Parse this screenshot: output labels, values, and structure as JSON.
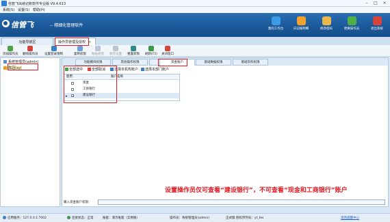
{
  "window": {
    "title": "信管飞出纳记账软件专业版 V9.4.613"
  },
  "menu": [
    "系统(S)",
    "设置(S)",
    "帮助(H)"
  ],
  "banner": {
    "logo": "信管飞",
    "slogan": "-- 精细化管理软件",
    "buttons": [
      "我的工作台",
      "日记账明细",
      "修改密码",
      "更换操作员",
      "退出系统"
    ]
  },
  "tabs": [
    "功能导航区",
    "操作员管理及授权"
  ],
  "toolbar": [
    "添加操作员",
    "删除操作员",
    "设置登录限制",
    "复制权限",
    "粘贴权限",
    "保存设置",
    "重置权限",
    "刷新(F5)",
    "关闭窗口"
  ],
  "tree": [
    "系统管理员(admin)",
    "陈冠(zy)"
  ],
  "subtabs": [
    "功能模块权限",
    "其他操作权限",
    "数据权限",
    "资金账户",
    "基础数据权限",
    "基础资料权限"
  ],
  "actions": [
    "全部选中",
    "全部取消",
    "选择本机构账户",
    "选择本部门账户"
  ],
  "grid": {
    "headers": [
      "使用",
      "账户名称"
    ],
    "rows": [
      {
        "name": "现金",
        "checked": false
      },
      {
        "name": "工商银行",
        "checked": false
      },
      {
        "name": "建设银行",
        "checked": true
      }
    ]
  },
  "annotation": "设置操作员仅可查看“建设银行”，不可查看“现金和工商银行”账户",
  "input_label": "输入资金账户权限：",
  "status": {
    "server": "应用服务：127.0.0.1:7002",
    "connection": "连接状态：正常",
    "ledger": "账套：演示账套（实例账）",
    "operator": "操作员：系统管理员(admin)",
    "register": "正式版 授权序列号：yt_fes",
    "msg": "消息提醒中心"
  },
  "colors": {
    "brand": "#1a5797",
    "annotation": "#e41b23"
  }
}
